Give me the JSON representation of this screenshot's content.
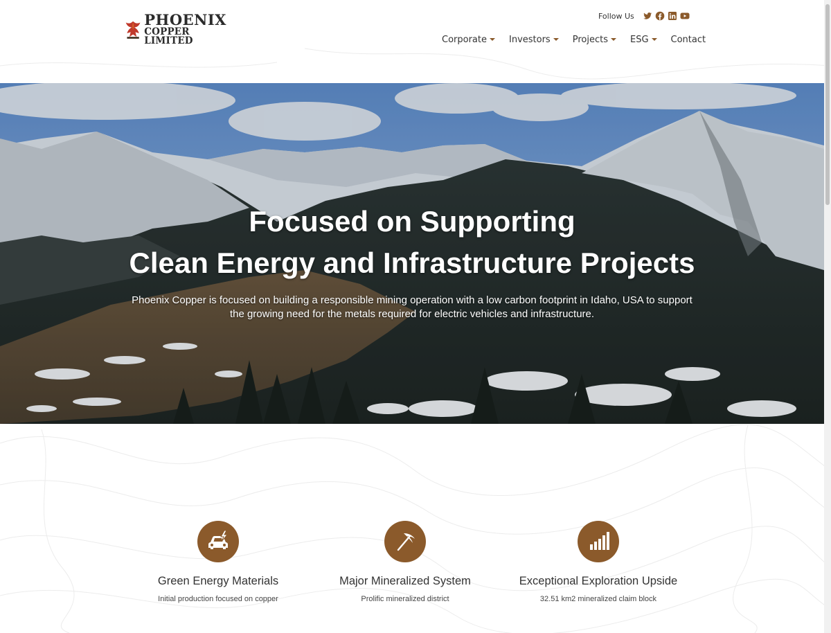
{
  "header": {
    "logo": {
      "line1": "PHOENIX",
      "line2": "COPPER LIMITED"
    },
    "follow_label": "Follow Us",
    "social": [
      "twitter-icon",
      "facebook-icon",
      "linkedin-icon",
      "youtube-icon"
    ],
    "nav": [
      {
        "label": "Corporate",
        "has_dropdown": true
      },
      {
        "label": "Investors",
        "has_dropdown": true
      },
      {
        "label": "Projects",
        "has_dropdown": true
      },
      {
        "label": "ESG",
        "has_dropdown": true
      },
      {
        "label": "Contact",
        "has_dropdown": false
      }
    ]
  },
  "hero": {
    "title_line1": "Focused on Supporting",
    "title_line2": "Clean Energy and Infrastructure Projects",
    "subtitle": "Phoenix Copper is focused on building a responsible mining operation with a low carbon footprint in Idaho, USA to support the growing need for the metals required for electric vehicles and infrastructure."
  },
  "features": [
    {
      "icon": "electric-car-icon",
      "title": "Green Energy Materials",
      "desc": "Initial production focused on copper"
    },
    {
      "icon": "pickaxe-icon",
      "title": "Major Mineralized System",
      "desc": "Prolific mineralized district"
    },
    {
      "icon": "bar-chart-icon",
      "title": "Exceptional Exploration Upside",
      "desc": "32.51 km2 mineralized claim block"
    }
  ],
  "colors": {
    "accent": "#8b5a2b",
    "text": "#333333",
    "sky": "#6f9ed6"
  }
}
